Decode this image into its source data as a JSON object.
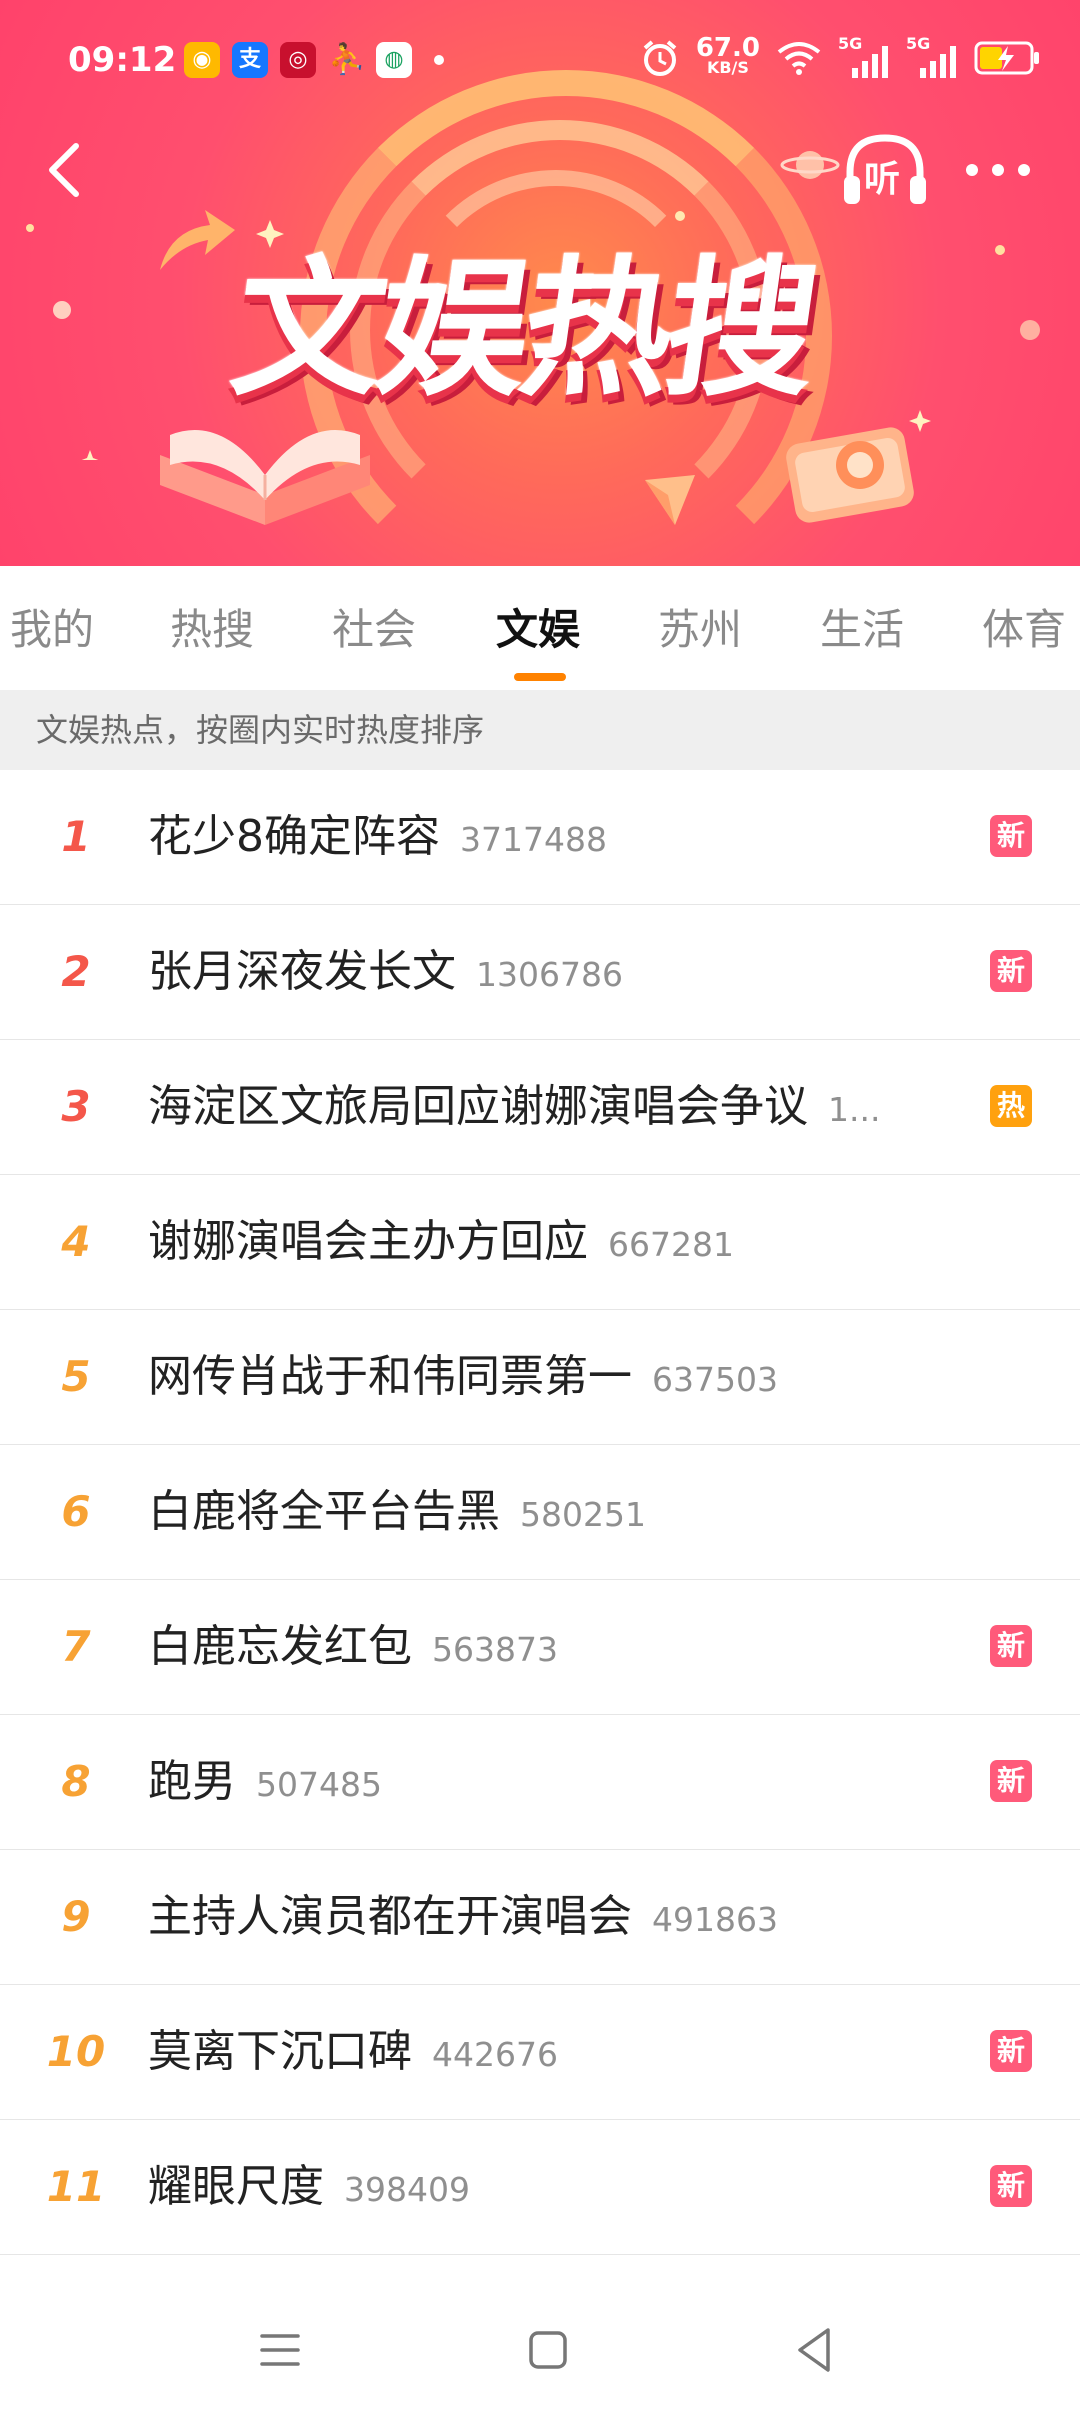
{
  "status_bar": {
    "time": "09:12",
    "net_speed_value": "67.0",
    "net_speed_unit": "KB/S",
    "signal_1": "5G",
    "signal_2": "5G",
    "app_icons": [
      "weibo-app-icon",
      "alipay-app-icon",
      "bank-app-icon",
      "pinduoduo-app-icon",
      "china-mobile-app-icon"
    ]
  },
  "header": {
    "banner_title": "文娱热搜",
    "listen_label": "听"
  },
  "tabs": [
    {
      "label": "我的"
    },
    {
      "label": "热搜"
    },
    {
      "label": "社会"
    },
    {
      "label": "文娱",
      "active": true
    },
    {
      "label": "苏州"
    },
    {
      "label": "生活"
    },
    {
      "label": "体育"
    }
  ],
  "subtitle": "文娱热点，按圈内实时热度排序",
  "hot_list": [
    {
      "rank": "1",
      "title": "花少8确定阵容",
      "count": "3717488",
      "badge": "新",
      "badge_type": "new"
    },
    {
      "rank": "2",
      "title": "张月深夜发长文",
      "count": "1306786",
      "badge": "新",
      "badge_type": "new"
    },
    {
      "rank": "3",
      "title": "海淀区文旅局回应谢娜演唱会争议",
      "count": "1...",
      "badge": "热",
      "badge_type": "hot"
    },
    {
      "rank": "4",
      "title": "谢娜演唱会主办方回应",
      "count": "667281",
      "badge": "",
      "badge_type": ""
    },
    {
      "rank": "5",
      "title": "网传肖战于和伟同票第一",
      "count": "637503",
      "badge": "",
      "badge_type": ""
    },
    {
      "rank": "6",
      "title": "白鹿将全平台告黑",
      "count": "580251",
      "badge": "",
      "badge_type": ""
    },
    {
      "rank": "7",
      "title": "白鹿忘发红包",
      "count": "563873",
      "badge": "新",
      "badge_type": "new"
    },
    {
      "rank": "8",
      "title": "跑男",
      "count": "507485",
      "badge": "新",
      "badge_type": "new"
    },
    {
      "rank": "9",
      "title": "主持人演员都在开演唱会",
      "count": "491863",
      "badge": "",
      "badge_type": ""
    },
    {
      "rank": "10",
      "title": "莫离下沉口碑",
      "count": "442676",
      "badge": "新",
      "badge_type": "new"
    },
    {
      "rank": "11",
      "title": "耀眼尺度",
      "count": "398409",
      "badge": "新",
      "badge_type": "new"
    }
  ],
  "colors": {
    "rank_top3": "#f4574a",
    "rank_other": "#f7a234",
    "badge_new": "#ff5a7a",
    "badge_hot": "#ffa10e",
    "tab_indicator": "#ff8200"
  }
}
